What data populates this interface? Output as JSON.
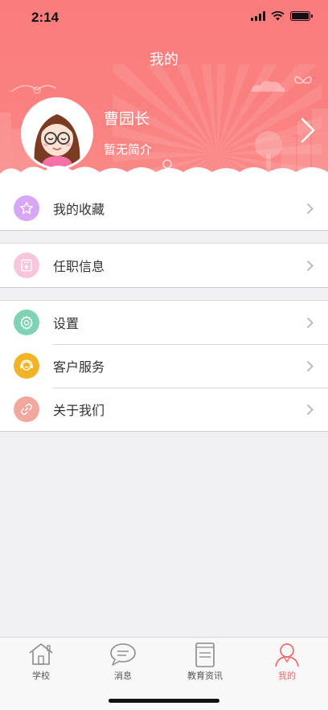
{
  "status_bar": {
    "time": "2:14"
  },
  "header": {
    "title": "我的",
    "user_name": "曹园长",
    "user_bio": "暂无简介"
  },
  "menu": {
    "favorites": {
      "label": "我的收藏",
      "icon": "star-icon",
      "color": "#d7a6f4"
    },
    "job_info": {
      "label": "任职信息",
      "icon": "id-card-icon",
      "color": "#f7c6dd"
    },
    "settings": {
      "label": "设置",
      "icon": "gear-icon",
      "color": "#7ed3b3"
    },
    "customer_service": {
      "label": "客户服务",
      "icon": "headset-icon",
      "color": "#f4b325"
    },
    "about": {
      "label": "关于我们",
      "icon": "link-icon",
      "color": "#f2a89c"
    }
  },
  "tabbar": {
    "items": [
      {
        "label": "学校",
        "icon": "house-icon"
      },
      {
        "label": "消息",
        "icon": "chat-bubble-icon"
      },
      {
        "label": "教育资讯",
        "icon": "book-icon"
      },
      {
        "label": "我的",
        "icon": "person-icon"
      }
    ],
    "active_index": 3,
    "active_color": "#f36a6a"
  },
  "colors": {
    "header_bg": "#fa7f7f",
    "page_bg": "#efeff4"
  }
}
